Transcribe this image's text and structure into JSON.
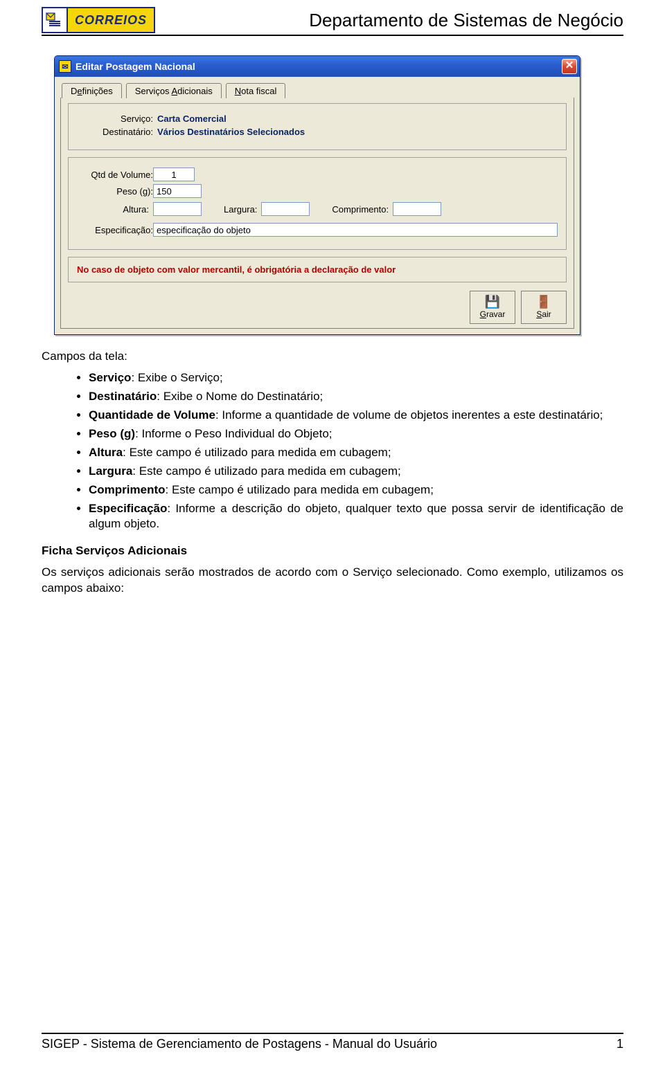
{
  "header": {
    "logo_word": "CORREIOS",
    "department": "Departamento de Sistemas de Negócio"
  },
  "dialog": {
    "title": "Editar Postagem Nacional",
    "close": "✕",
    "tabs": {
      "t1_pre": "D",
      "t1_u": "e",
      "t1_post": "finições",
      "t2_pre": "Serviços ",
      "t2_u": "A",
      "t2_post": "dicionais",
      "t3_pre": "",
      "t3_u": "N",
      "t3_post": "ota fiscal"
    },
    "labels": {
      "servico": "Serviço:",
      "destinatario": "Destinatário:",
      "qtd": "Qtd de Volume:",
      "peso": "Peso (g):",
      "altura": "Altura:",
      "largura": "Largura:",
      "comprimento": "Comprimento:",
      "especificacao": "Especificação:"
    },
    "values": {
      "servico": "Carta Comercial",
      "destinatario": "Vários Destinatários Selecionados",
      "qtd": "1",
      "peso": "150",
      "altura": "",
      "largura": "",
      "comprimento": "",
      "especificacao": "especificação do objeto"
    },
    "warning": "No caso de objeto com valor mercantil, é obrigatória a declaração de valor",
    "buttons": {
      "gravar_u": "G",
      "gravar_post": "ravar",
      "sair_u": "S",
      "sair_post": "air"
    }
  },
  "body": {
    "campos_title": "Campos da tela:",
    "items": {
      "i1_b": "Serviço",
      "i1_t": ": Exibe o Serviço;",
      "i2_b": "Destinatário",
      "i2_t": ": Exibe o Nome do Destinatário;",
      "i3_b": "Quantidade de Volume",
      "i3_t": ": Informe a quantidade de volume de objetos inerentes a este destinatário;",
      "i4_b": "Peso (g)",
      "i4_t": ": Informe o Peso Individual do Objeto;",
      "i5_b": "Altura",
      "i5_t": ": Este campo é utilizado para medida em cubagem;",
      "i6_b": "Largura",
      "i6_t": ": Este campo é utilizado para medida em cubagem;",
      "i7_b": "Comprimento",
      "i7_t": ": Este campo é utilizado para medida em cubagem;",
      "i8_b": "Especificação",
      "i8_t": ": Informe a descrição do objeto, qualquer texto que possa servir de identificação de algum objeto."
    },
    "ficha_h": "Ficha Serviços Adicionais",
    "ficha_p": "Os serviços adicionais serão mostrados de acordo com o Serviço selecionado. Como exemplo, utilizamos os campos abaixo:"
  },
  "footer": {
    "left": "SIGEP - Sistema de Gerenciamento de Postagens - Manual do Usuário",
    "page": "1"
  }
}
